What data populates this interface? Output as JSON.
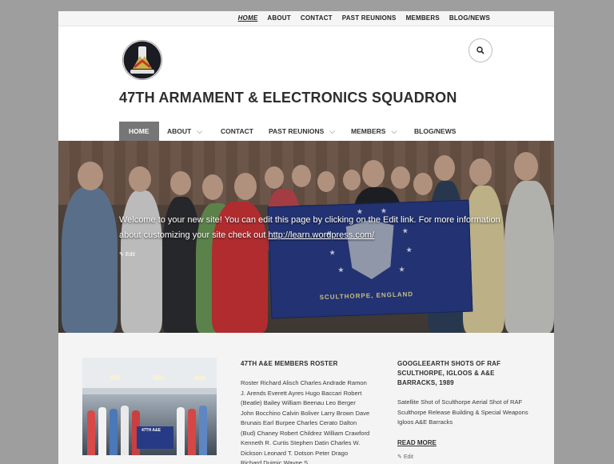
{
  "topnav": {
    "items": [
      "HOME",
      "ABOUT",
      "CONTACT",
      "PAST REUNIONS",
      "MEMBERS",
      "BLOG/NEWS"
    ]
  },
  "header": {
    "site_title": "47TH ARMAMENT & ELECTRONICS SQUADRON",
    "search_icon": "search-icon"
  },
  "mainnav": {
    "items": [
      "HOME",
      "ABOUT",
      "CONTACT",
      "PAST REUNIONS",
      "MEMBERS",
      "BLOG/NEWS"
    ]
  },
  "hero": {
    "message_text": "Welcome to your new site! You can edit this page by clicking on the Edit link. For more information about customizing your site check out ",
    "message_link": "http://learn.wordpress.com/",
    "edit_label": "Edit",
    "flag_text": "SCULTHORPE, ENGLAND"
  },
  "thumb": {
    "flag_text": "47TH A&E"
  },
  "roster": {
    "title": "47TH A&E MEMBERS ROSTER",
    "body": "Roster Richard Alisch Charles Andrade Ramon J. Arends Everett Ayres Hugo Baccari Robert (Beatle) Bailey William Beenau Leo Berger John Bocchino Calvin Boliver Larry Brown Dave Brunais Earl Burpee Charles Cerato Dalton (Bud) Chaney Robert Childrez William Crawford Kenneth R. Curtis Stephen Datin Charles W. Dickson Leonard T. Dotson Peter Drago Richard Dujmic Wayne S.…"
  },
  "google": {
    "title": "GOOGLEEARTH SHOTS OF RAF SCULTHORPE, IGLOOS & A&E BARRACKS, 1989",
    "body": "Satellite Shot of Sculthorpe Aerial Shot of RAF Sculthorpe Release Building & Special Weapons Igloos A&E Barracks",
    "read_more": "READ MORE",
    "edit_label": "Edit"
  },
  "colors": {
    "page_bg": "#9e9e9e",
    "active_nav": "#767676",
    "flag_blue": "#2a3e8c"
  }
}
